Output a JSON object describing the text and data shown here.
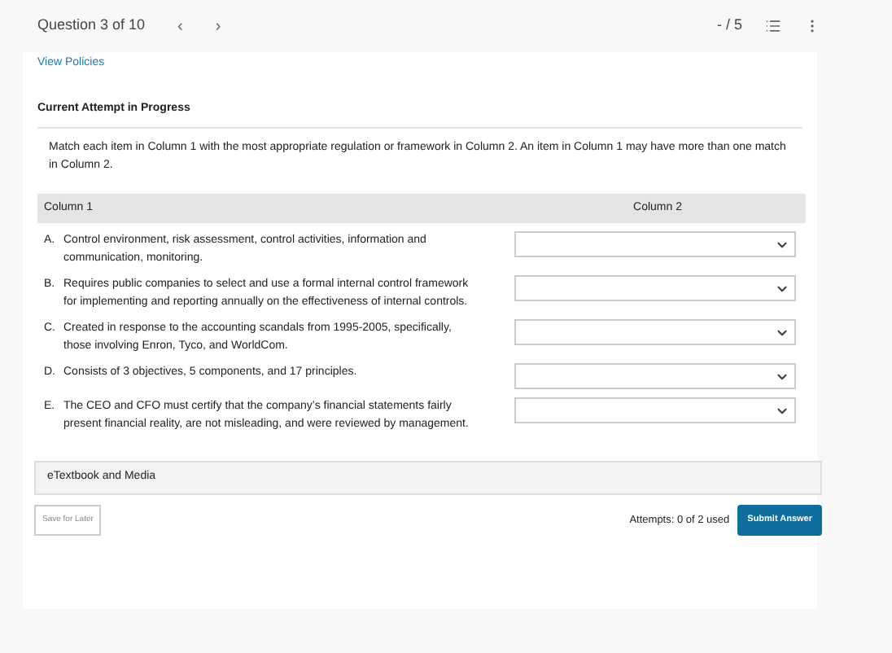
{
  "header": {
    "question": "Question 3 of 10",
    "prev": "‹",
    "next": "›",
    "score": "- / 5"
  },
  "link": "View Policies",
  "section_title": "Current Attempt in Progress",
  "instructions": "Match each item in Column 1 with the most appropriate regulation or framework in Column 2. An item in Column 1 may have more than one match in Column 2.",
  "table": {
    "columns": [
      "Column 1",
      "Column 2"
    ],
    "rows": [
      {
        "letter": "A.",
        "text": "Control environment, risk assessment, control activities, information and communication, monitoring."
      },
      {
        "letter": "B.",
        "text": "Requires public companies to select and use a formal internal control framework for implementing and reporting annually on the effectiveness of internal controls."
      },
      {
        "letter": "C.",
        "text": "Created in response to the accounting scandals from 1995-2005, specifically, those involving Enron, Tyco, and WorldCom."
      },
      {
        "letter": "D.",
        "text": "Consists of 3 objectives, 5 components, and 17 principles."
      },
      {
        "letter": "E.",
        "text": "The CEO and CFO must certify that the company’s financial statements fairly present financial reality, are not misleading, and were reviewed by management."
      }
    ]
  },
  "etextbook": "eTextbook and Media",
  "footer": {
    "save": "Save for Later",
    "attempts": "Attempts: 0 of 2 used",
    "submit": "Submit Answer"
  }
}
